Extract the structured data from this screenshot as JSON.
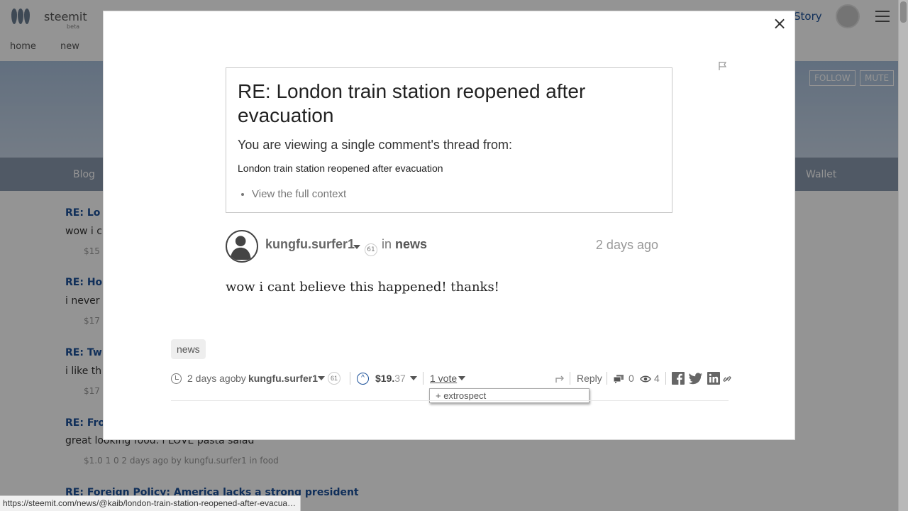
{
  "background": {
    "logo_text": "steemit",
    "logo_sub": "beta",
    "nav_right": "Story",
    "subnav": [
      "home",
      "new"
    ],
    "follow_label": "FOLLOW",
    "mute_label": "MUTE",
    "tabs": {
      "left": "Blog",
      "right": "Wallet"
    },
    "items": [
      {
        "title": "RE: Lo",
        "body": "wow i c",
        "meta": "$15"
      },
      {
        "title": "RE: Ho",
        "body": "i never",
        "meta": "$17"
      },
      {
        "title": "RE: Tw",
        "body": "i like th",
        "meta": "$17"
      },
      {
        "title": "RE: Fro",
        "body": "great looking food. i LOVE pasta salad",
        "meta": "$1.0  1  0  2 days ago by kungfu.surfer1  in food"
      },
      {
        "title": "RE: Foreign Policy: America lacks a strong president",
        "body": "",
        "meta": ""
      }
    ]
  },
  "modal": {
    "close_label": "×",
    "context": {
      "title": "RE: London train station reopened after evacuation",
      "subtitle": "You are viewing a single comment's thread from:",
      "parent_title": "London train station reopened after evacuation",
      "full_context_link": "View the full context"
    },
    "author": {
      "name": "kungfu.surfer1",
      "reputation": "61",
      "in_label": "in",
      "category": "news",
      "time_ago": "2 days ago"
    },
    "comment_text": "wow i cant believe this happened! thanks!",
    "tag": "news",
    "footer": {
      "time_ago": "2 days ago",
      "by_label": "by",
      "author": "kungfu.surfer1",
      "reputation": "61",
      "payout_whole": "$19.",
      "payout_decimal": "37",
      "votes_label": "1 vote",
      "voter": "+ extrospect",
      "reply_label": "Reply",
      "comment_count": "0",
      "view_count": "4"
    }
  },
  "status_bar": {
    "url": "https://steemit.com/news/@kaib/london-train-station-reopened-after-evacuati..."
  },
  "colors": {
    "accent_blue": "#1a5099",
    "overlay": "rgba(0,0,0,0.42)"
  }
}
